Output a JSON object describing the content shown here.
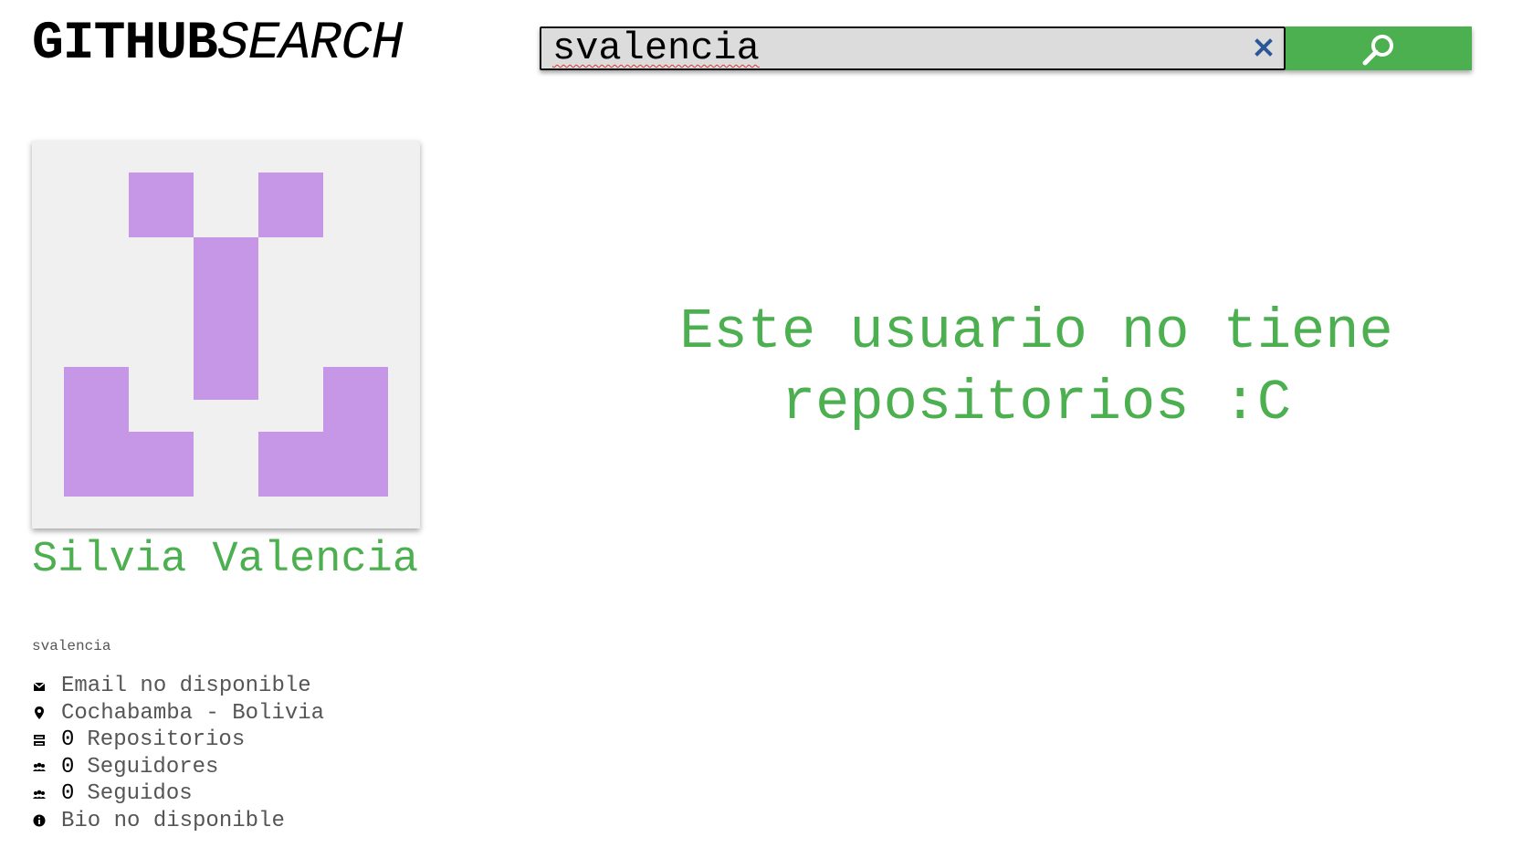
{
  "header": {
    "logo_bold": "GITHUB",
    "logo_italic": "SEARCH"
  },
  "search": {
    "value": "svalencia",
    "clear_icon": "close-icon",
    "button_icon": "search-icon",
    "accent_color": "#4caf50"
  },
  "profile": {
    "avatar_color": "#c597e6",
    "name": "Silvia Valencia",
    "username": "svalencia",
    "details": [
      {
        "icon": "envelope-icon",
        "text": "Email no disponible"
      },
      {
        "icon": "map-pin-icon",
        "text": "Cochabamba - Bolivia"
      },
      {
        "icon": "repository-icon",
        "count": "0",
        "text": "Repositorios"
      },
      {
        "icon": "users-icon",
        "count": "0",
        "text": "Seguidores"
      },
      {
        "icon": "users-icon",
        "count": "0",
        "text": "Seguidos"
      },
      {
        "icon": "info-icon",
        "text": "Bio no disponible"
      }
    ]
  },
  "main": {
    "empty_message": "Este usuario no tiene repositorios :C"
  }
}
